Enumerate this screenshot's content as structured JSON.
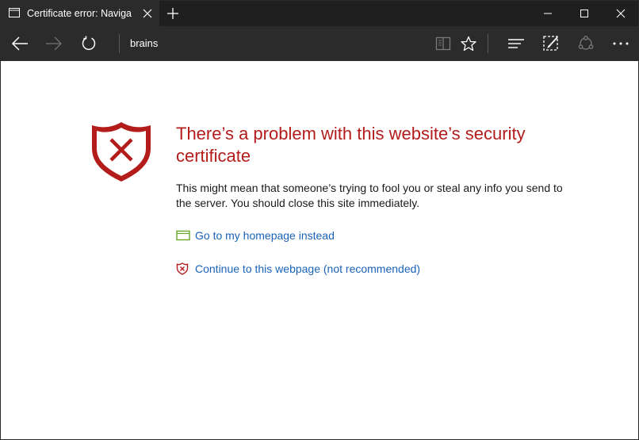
{
  "tab": {
    "title": "Certificate error: Naviga"
  },
  "toolbar": {
    "address": "brains"
  },
  "page": {
    "heading": "There’s a problem with this website’s security certificate",
    "description": "This might mean that someone’s trying to fool you or steal any info you send to the server. You should close this site immediately.",
    "home_link": "Go to my homepage instead",
    "continue_link": "Continue to this webpage (not recommended)"
  },
  "colors": {
    "chrome_dark": "#1f1f1f",
    "toolbar": "#2b2b2b",
    "error_red": "#b41c1c",
    "link_blue": "#1a62b8",
    "home_icon_green": "#6aa62a"
  },
  "icons": {
    "tab_favicon": "page-icon",
    "tab_close": "close-icon",
    "new_tab": "plus-icon",
    "minimize": "minimize-icon",
    "maximize": "maximize-icon",
    "close_window": "close-icon",
    "back": "back-arrow-icon",
    "forward": "forward-arrow-icon",
    "refresh": "refresh-icon",
    "reading_view": "book-icon",
    "favorite": "star-icon",
    "hub": "hub-icon",
    "web_note": "web-note-icon",
    "share": "share-icon",
    "more": "more-icon",
    "shield": "shield-error-icon",
    "home_link_icon": "homepage-icon",
    "continue_link_icon": "shield-small-icon"
  }
}
